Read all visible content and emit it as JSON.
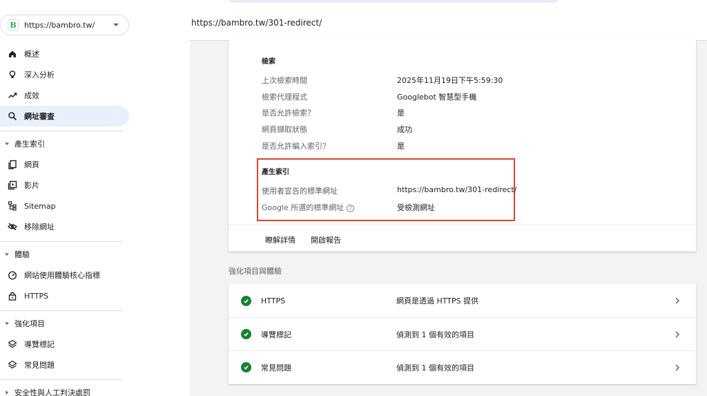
{
  "property": {
    "url": "https://bambro.tw/",
    "logo_letter": "B"
  },
  "sidebar": {
    "items": [
      {
        "label": "概述",
        "icon": "home-icon"
      },
      {
        "label": "深入分析",
        "icon": "lightbulb-icon"
      },
      {
        "label": "成效",
        "icon": "trending-icon"
      },
      {
        "label": "網址審查",
        "icon": "search-icon",
        "active": true
      }
    ],
    "sections": [
      {
        "title": "產生索引",
        "items": [
          "網頁",
          "影片",
          "Sitemap",
          "移除網址"
        ]
      },
      {
        "title": "體驗",
        "items": [
          "網站使用體驗核心指標",
          "HTTPS"
        ]
      },
      {
        "title": "強化項目",
        "items": [
          "導覽標記",
          "常見問題"
        ]
      },
      {
        "title": "安全性與人工判決處罰",
        "items": []
      }
    ]
  },
  "header": {
    "inspected_url": "https://bambro.tw/301-redirect/"
  },
  "crawl": {
    "title": "檢索",
    "rows": [
      {
        "label": "上次檢索時間",
        "value": "2025年11月19日下午5:59:30"
      },
      {
        "label": "檢索代理程式",
        "value": "Googlebot 智慧型手機"
      },
      {
        "label": "是否允許檢索？",
        "value": "是"
      },
      {
        "label": "網頁擷取狀態",
        "value": "成功"
      },
      {
        "label": "是否允許編入索引？",
        "value": "是"
      }
    ]
  },
  "indexing": {
    "title": "產生索引",
    "rows": [
      {
        "label": "使用者宣告的標準網址",
        "value": "https://bambro.tw/301-redirect/"
      },
      {
        "label": "Google 所選的標準網址",
        "value": "受檢測網址",
        "help": "?"
      }
    ]
  },
  "card_links": {
    "learn_more": "瞭解詳情",
    "open_report": "開啟報告"
  },
  "enhancements": {
    "title": "強化項目與體驗",
    "rows": [
      {
        "name": "HTTPS",
        "desc": "網頁是透過 HTTPS 提供"
      },
      {
        "name": "導覽標記",
        "desc": "偵測到 1 個有效的項目"
      },
      {
        "name": "常見問題",
        "desc": "偵測到 1 個有效的項目"
      }
    ]
  },
  "colors": {
    "accent_active_bg": "#e8f0fe",
    "highlight_border": "#d9432b",
    "valid_green": "#188038"
  }
}
